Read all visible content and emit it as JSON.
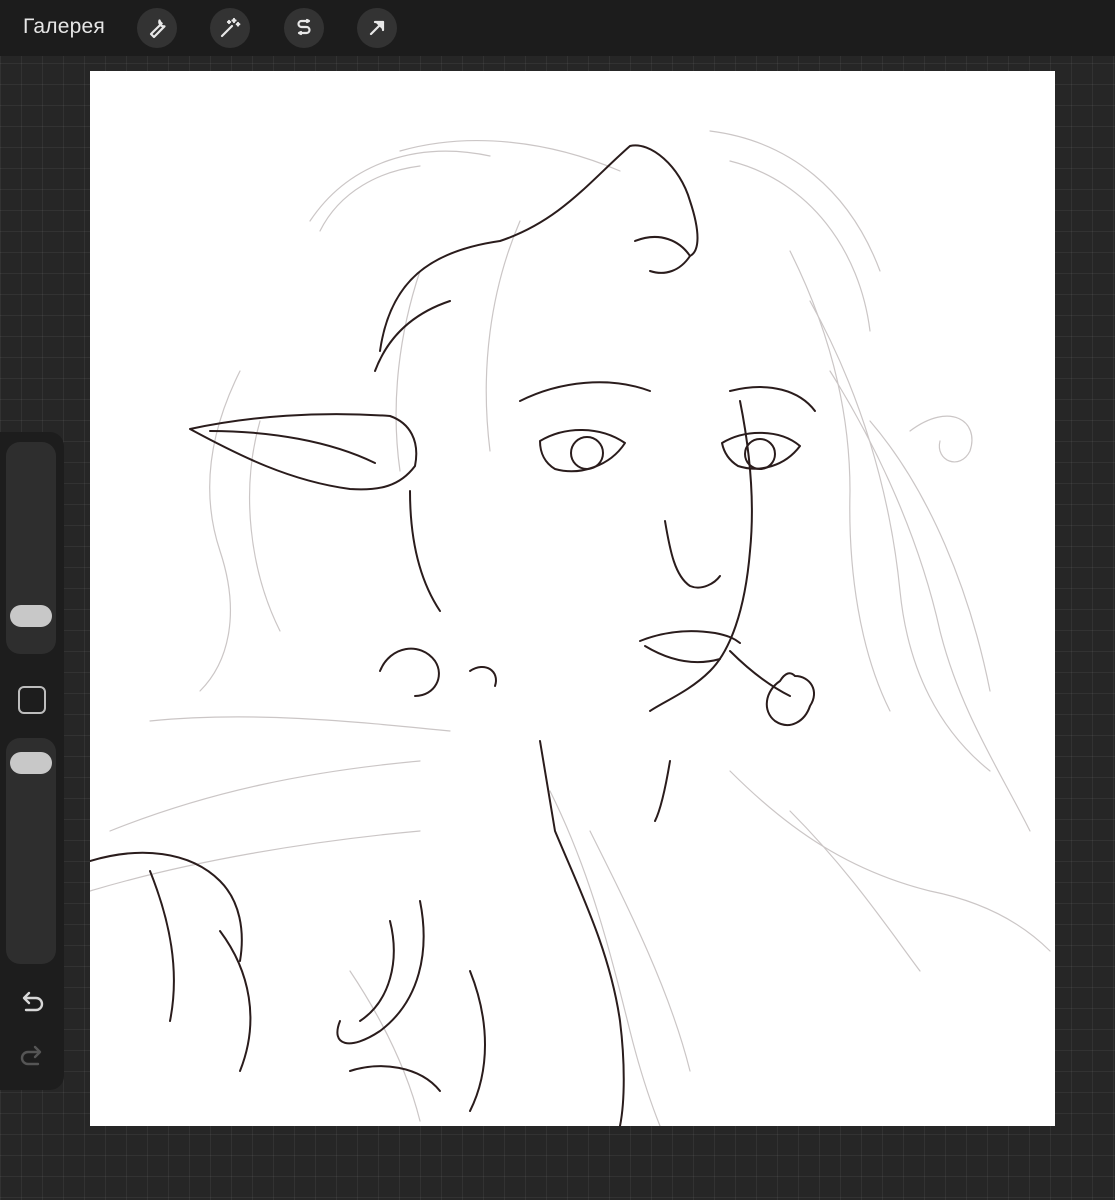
{
  "app": {
    "gallery_label": "Галерея"
  },
  "toolbar": {
    "tools": [
      {
        "icon": "wrench-icon",
        "name": "actions"
      },
      {
        "icon": "magic-wand-icon",
        "name": "adjustments"
      },
      {
        "icon": "selection-icon",
        "name": "selection"
      },
      {
        "icon": "transform-arrow-icon",
        "name": "transform"
      }
    ]
  },
  "sidebar": {
    "brush_size_level": 0.2,
    "opacity_level": 0.8
  },
  "colors": {
    "background": "#262626",
    "topbar": "#1c1c1c",
    "sidebar": "#1d1d1d",
    "canvas": "#ffffff",
    "ink": "#2a1c1c",
    "sketch": "#c9c4c4"
  }
}
